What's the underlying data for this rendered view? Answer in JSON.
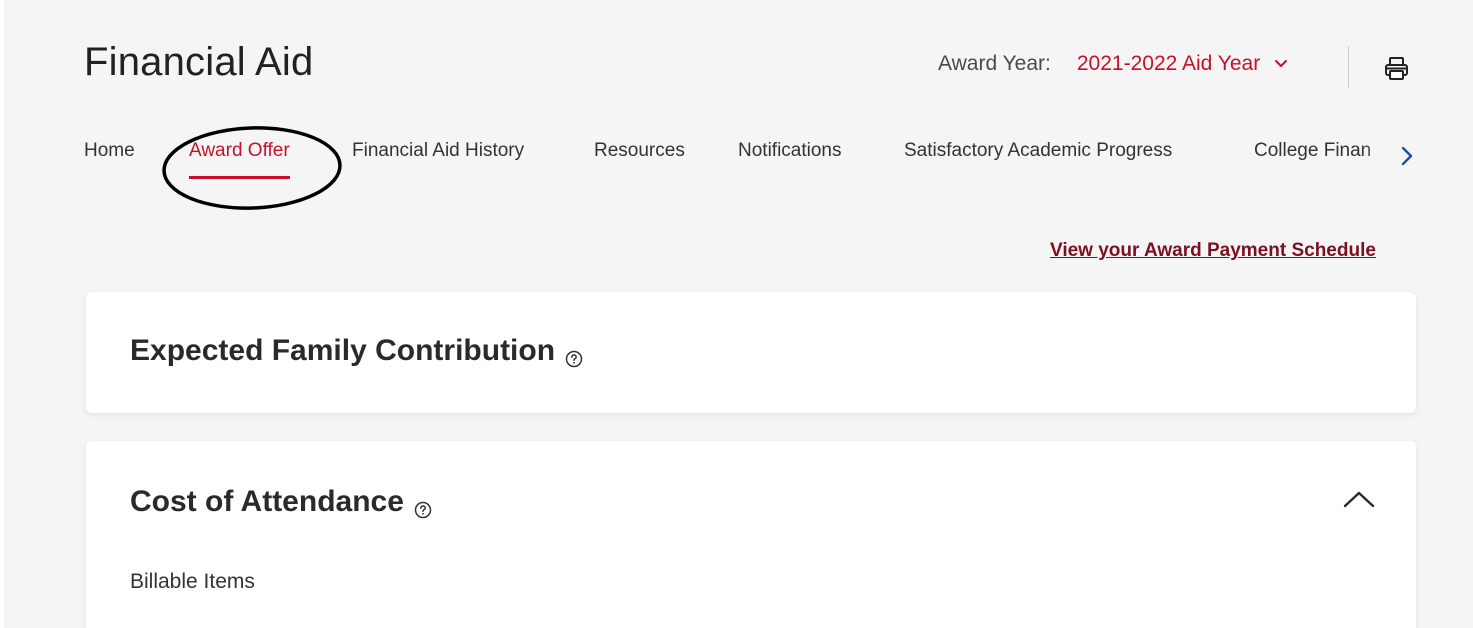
{
  "header": {
    "title": "Financial Aid",
    "award_year_label": "Award Year:",
    "award_year_value": "2021-2022 Aid Year"
  },
  "tabs": [
    {
      "label": "Home",
      "active": false
    },
    {
      "label": "Award Offer",
      "active": true
    },
    {
      "label": "Financial Aid History",
      "active": false
    },
    {
      "label": "Resources",
      "active": false
    },
    {
      "label": "Notifications",
      "active": false
    },
    {
      "label": "Satisfactory Academic Progress",
      "active": false
    },
    {
      "label": "College Finan",
      "active": false
    }
  ],
  "links": {
    "payment_schedule": "View your Award Payment Schedule"
  },
  "cards": {
    "efc": {
      "title": "Expected Family Contribution"
    },
    "coa": {
      "title": "Cost of Attendance",
      "section_label": "Billable Items"
    }
  },
  "colors": {
    "accent": "#c8102e",
    "link": "#7a1020",
    "background": "#f5f5f5"
  },
  "icons": {
    "award_year_dropdown": "chevron-down-icon",
    "print": "printer-icon",
    "tabs_scroll": "chevron-right-icon",
    "help": "help-circle-icon",
    "collapse": "chevron-up-icon"
  }
}
